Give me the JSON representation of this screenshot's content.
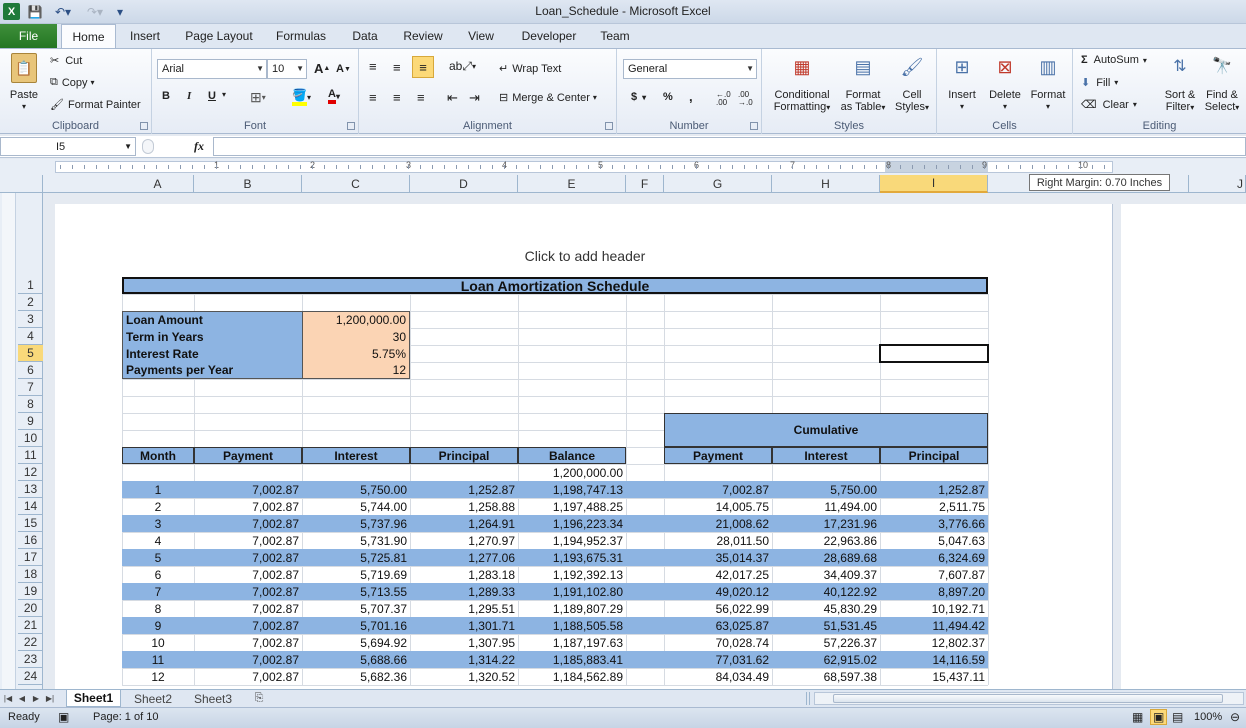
{
  "window": {
    "title": "Loan_Schedule - Microsoft Excel"
  },
  "tabs": [
    "Home",
    "Insert",
    "Page Layout",
    "Formulas",
    "Data",
    "Review",
    "View",
    "Developer",
    "Team"
  ],
  "file_tab": "File",
  "clipboard": {
    "paste": "Paste",
    "cut": "Cut",
    "copy": "Copy",
    "format_painter": "Format Painter",
    "label": "Clipboard"
  },
  "font": {
    "name": "Arial",
    "size": "10",
    "label": "Font",
    "bold": "B",
    "italic": "I",
    "underline": "U"
  },
  "alignment": {
    "wrap": "Wrap Text",
    "merge": "Merge & Center",
    "label": "Alignment"
  },
  "number": {
    "format": "General",
    "label": "Number",
    "dollar": "$",
    "percent": "%",
    "comma": ","
  },
  "styles": {
    "conditional1": "Conditional",
    "conditional2": "Formatting",
    "format_table1": "Format",
    "format_table2": "as Table",
    "cell_styles1": "Cell",
    "cell_styles2": "Styles",
    "label": "Styles"
  },
  "cells_group": {
    "insert": "Insert",
    "delete": "Delete",
    "format": "Format",
    "label": "Cells"
  },
  "editing": {
    "autosum": "AutoSum",
    "fill": "Fill",
    "clear": "Clear",
    "sort1": "Sort &",
    "sort2": "Filter",
    "find1": "Find &",
    "find2": "Select",
    "label": "Editing"
  },
  "namebox": "I5",
  "fx": "fx",
  "ruler_numbers": [
    "1",
    "2",
    "3",
    "4",
    "5",
    "6",
    "7",
    "8",
    "9",
    "10"
  ],
  "columns": [
    "A",
    "B",
    "C",
    "D",
    "E",
    "F",
    "G",
    "H",
    "I",
    "J"
  ],
  "tooltip": "Right Margin: 0.70 Inches",
  "header_placeholder": "Click to add header",
  "sheet": {
    "title": "Loan Amortization Schedule",
    "inputs": [
      {
        "label": "Loan Amount",
        "value": "1,200,000.00"
      },
      {
        "label": "Term in Years",
        "value": "30"
      },
      {
        "label": "Interest Rate",
        "value": "5.75%"
      },
      {
        "label": "Payments per Year",
        "value": "12"
      }
    ],
    "cumulative": "Cumulative",
    "headers": [
      "Month",
      "Payment",
      "Interest",
      "Principal",
      "Balance",
      "Payment",
      "Interest",
      "Principal"
    ],
    "initial_balance": "1,200,000.00",
    "rows": [
      [
        "1",
        "7,002.87",
        "5,750.00",
        "1,252.87",
        "1,198,747.13",
        "7,002.87",
        "5,750.00",
        "1,252.87"
      ],
      [
        "2",
        "7,002.87",
        "5,744.00",
        "1,258.88",
        "1,197,488.25",
        "14,005.75",
        "11,494.00",
        "2,511.75"
      ],
      [
        "3",
        "7,002.87",
        "5,737.96",
        "1,264.91",
        "1,196,223.34",
        "21,008.62",
        "17,231.96",
        "3,776.66"
      ],
      [
        "4",
        "7,002.87",
        "5,731.90",
        "1,270.97",
        "1,194,952.37",
        "28,011.50",
        "22,963.86",
        "5,047.63"
      ],
      [
        "5",
        "7,002.87",
        "5,725.81",
        "1,277.06",
        "1,193,675.31",
        "35,014.37",
        "28,689.68",
        "6,324.69"
      ],
      [
        "6",
        "7,002.87",
        "5,719.69",
        "1,283.18",
        "1,192,392.13",
        "42,017.25",
        "34,409.37",
        "7,607.87"
      ],
      [
        "7",
        "7,002.87",
        "5,713.55",
        "1,289.33",
        "1,191,102.80",
        "49,020.12",
        "40,122.92",
        "8,897.20"
      ],
      [
        "8",
        "7,002.87",
        "5,707.37",
        "1,295.51",
        "1,189,807.29",
        "56,022.99",
        "45,830.29",
        "10,192.71"
      ],
      [
        "9",
        "7,002.87",
        "5,701.16",
        "1,301.71",
        "1,188,505.58",
        "63,025.87",
        "51,531.45",
        "11,494.42"
      ],
      [
        "10",
        "7,002.87",
        "5,694.92",
        "1,307.95",
        "1,187,197.63",
        "70,028.74",
        "57,226.37",
        "12,802.37"
      ],
      [
        "11",
        "7,002.87",
        "5,688.66",
        "1,314.22",
        "1,185,883.41",
        "77,031.62",
        "62,915.02",
        "14,116.59"
      ],
      [
        "12",
        "7,002.87",
        "5,682.36",
        "1,320.52",
        "1,184,562.89",
        "84,034.49",
        "68,597.38",
        "15,437.11"
      ]
    ]
  },
  "row_numbers": [
    "1",
    "2",
    "3",
    "4",
    "5",
    "6",
    "7",
    "8",
    "9",
    "10",
    "11",
    "12",
    "13",
    "14",
    "15",
    "16",
    "17",
    "18",
    "19",
    "20",
    "21",
    "22",
    "23",
    "24"
  ],
  "sheet_tabs": [
    "Sheet1",
    "Sheet2",
    "Sheet3"
  ],
  "status": {
    "ready": "Ready",
    "page": "Page: 1 of 10",
    "zoom": "100%"
  },
  "colors": {
    "table_blue": "#8db4e2",
    "input_peach": "#fbd4b4",
    "selection": "#f9d97a"
  }
}
